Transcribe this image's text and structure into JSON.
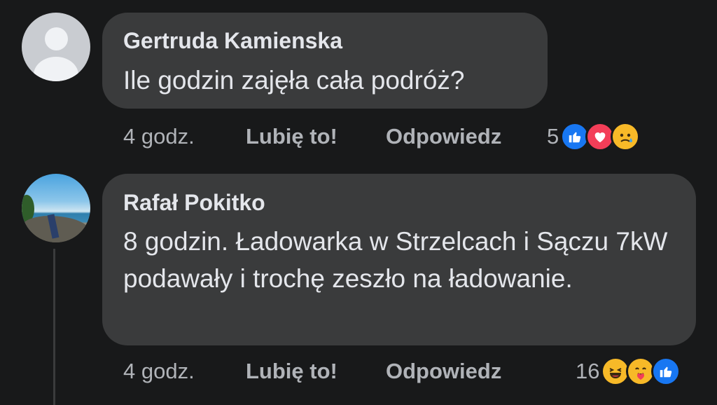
{
  "comments": [
    {
      "author": "Gertruda Kamienska",
      "text": "Ile godzin zajęła cała podróż?",
      "time": "4 godz.",
      "like_label": "Lubię to!",
      "reply_label": "Odpowiedz",
      "reaction_count": "5",
      "reactions": [
        "like-icon",
        "love-icon",
        "sad-icon"
      ]
    },
    {
      "author": "Rafał Pokitko",
      "text": "8 godzin. Ładowarka w Strzelcach i Sączu 7kW podawały i trochę zeszło na ładowanie.",
      "time": "4 godz.",
      "like_label": "Lubię to!",
      "reply_label": "Odpowiedz",
      "reaction_count": "16",
      "reactions": [
        "haha-icon",
        "care-icon",
        "like-icon"
      ]
    }
  ],
  "colors": {
    "background": "#18191a",
    "bubble": "#3a3b3c",
    "primary_text": "#e4e6eb",
    "secondary_text": "#b0b3b8",
    "like_blue": "#1877f2",
    "love_red": "#f33e58",
    "emoji_yellow": "#f7b928"
  }
}
